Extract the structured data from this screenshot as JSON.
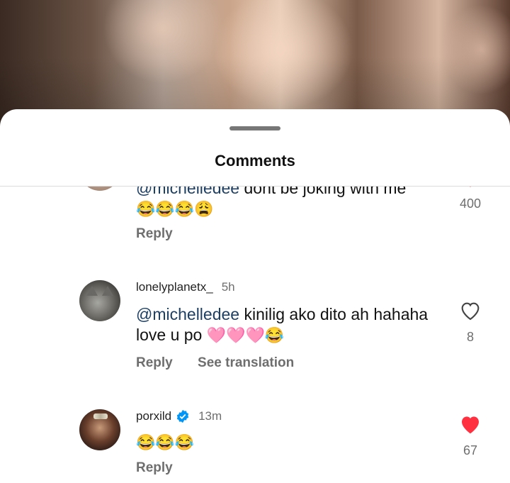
{
  "sheet": {
    "title": "Comments"
  },
  "comments": [
    {
      "username": "",
      "time": "",
      "mention": "@michelledee",
      "text": " dont be joking with me",
      "emojis": "😂😂😂😩",
      "reply_label": "Reply",
      "translate_label": "",
      "likes": "400",
      "liked": true
    },
    {
      "username": "lonelyplanetx_",
      "time": "5h",
      "mention": "@michelledee",
      "text": " kinilig ako dito ah hahaha love u po ",
      "emojis": "🩷🩷🩷😂",
      "reply_label": "Reply",
      "translate_label": "See translation",
      "likes": "8",
      "liked": false
    },
    {
      "username": "porxild",
      "time": "13m",
      "mention": "",
      "text": "",
      "emojis": "😂😂😂",
      "reply_label": "Reply",
      "translate_label": "",
      "likes": "67",
      "liked": true,
      "verified": true
    }
  ],
  "colors": {
    "liked": "#ff3040",
    "mention": "#1c3f63",
    "verified": "#0095f6"
  }
}
